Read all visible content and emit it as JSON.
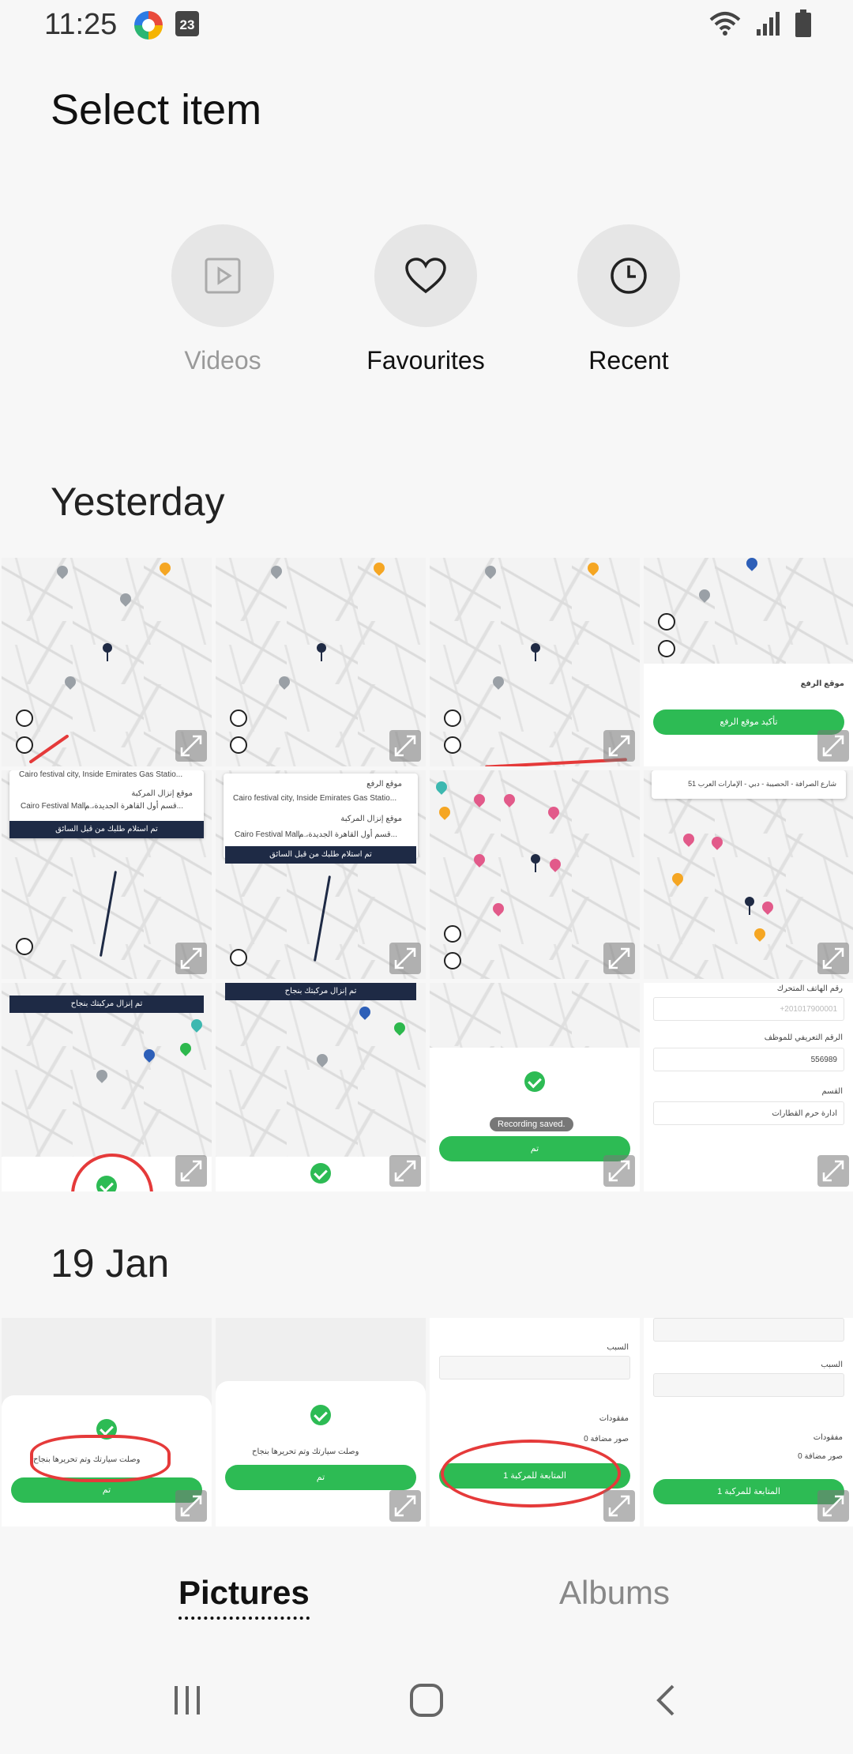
{
  "status_bar": {
    "time": "11:25",
    "calendar_day": "23"
  },
  "header": {
    "title": "Select item"
  },
  "shortcuts": [
    {
      "label": "Videos",
      "icon": "video-play-icon",
      "disabled": true
    },
    {
      "label": "Favourites",
      "icon": "heart-icon",
      "disabled": false
    },
    {
      "label": "Recent",
      "icon": "clock-icon",
      "disabled": false
    }
  ],
  "sections": [
    {
      "title": "Yesterday",
      "count": 12
    },
    {
      "title": "19 Jan",
      "count": 4
    }
  ],
  "thumb_text": {
    "pickup_location": "موقع الرفع",
    "confirm_pickup": "تأكيد موقع الرفع",
    "pickup_from_driver": "تم استلام طلبك من قبل السائق",
    "cairo_festival": "Cairo festival city, Inside Emirates Gas Statio...",
    "drop_location": "موقع إنزال المركبة",
    "cairo_festival_mall": "Cairo Festival Mall...",
    "cairo_mall_ar": "قسم أول القاهرة الجديدة، م...",
    "address_uae": "51 شارع الصرافة - الحصيبة - دبي - الإمارات العرب",
    "vehicle_dropped": "تم إنزال مركبتك بنجاح",
    "recording_saved": "Recording saved.",
    "done": "تم",
    "employee_id_label": "الرقم التعريفي للموظف",
    "employee_id": "556989",
    "department_label": "القسم",
    "department": "ادارة حرم القطارات",
    "phone_label": "رقم الهاتف المتحرك",
    "phone_value": "+201017900001",
    "arrived_released": "وصلت سيارتك وتم تحريرها بنجاح",
    "reason": "السبب",
    "missing": "مفقودات",
    "no_images": "0 صور مضافة",
    "follow_vehicle": "المتابعة للمركبة 1"
  },
  "tabs": {
    "pictures": "Pictures",
    "albums": "Albums"
  }
}
